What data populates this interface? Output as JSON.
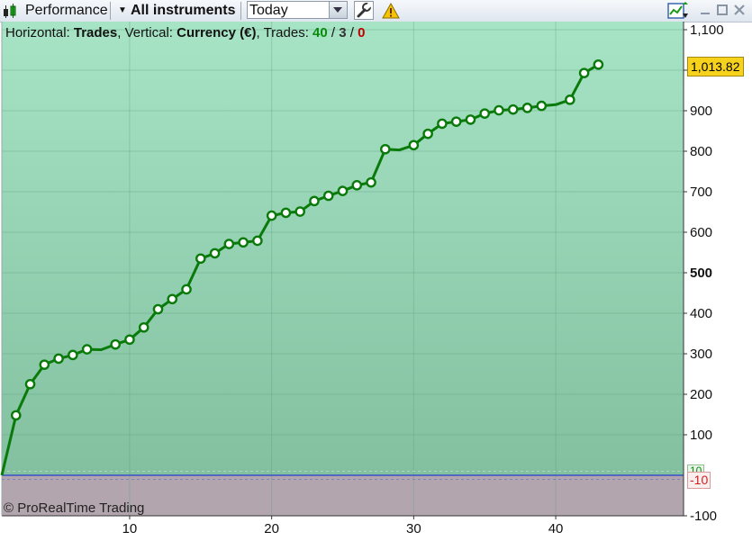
{
  "toolbar": {
    "module_label": "Performance",
    "instruments_label": "All instruments",
    "period_value": "Today",
    "icons": [
      "candlestick-icon",
      "dropdown-arrow-icon",
      "wrench-icon",
      "warning-icon",
      "chart-share-icon",
      "minimize-icon",
      "maximize-icon",
      "close-icon"
    ]
  },
  "info": {
    "horizontal_label": "Horizontal:",
    "horizontal_value": "Trades",
    "vertical_label": "Vertical:",
    "vertical_value": "Currency (€)",
    "trades_label": "Trades:",
    "trades_win": "40",
    "trades_even": "3",
    "trades_loss": "0",
    "separator": "/"
  },
  "copyright": "© ProRealTime Trading",
  "last_value_label": "1,013.82",
  "pos_tag": "10",
  "neg_tag": "-10",
  "colors": {
    "profit_bg_top": "#a7e4c6",
    "profit_bg_bottom": "#82c0a0",
    "loss_bg": "#b3a5ae",
    "line": "#0a7a0a",
    "baseline": "#3a50c8",
    "last_value_bg": "#f6d21d"
  },
  "chart_data": {
    "type": "line",
    "xlabel": "",
    "ylabel": "",
    "xlim": [
      1,
      49
    ],
    "ylim": [
      -100,
      1120
    ],
    "x_ticks": [
      10,
      20,
      30,
      40
    ],
    "y_ticks": [
      -100,
      100,
      200,
      300,
      400,
      500,
      600,
      700,
      800,
      900,
      1000,
      1100
    ],
    "y_tick_labels": [
      "-100",
      "100",
      "200",
      "300",
      "400",
      "500",
      "600",
      "700",
      "800",
      "900",
      "1,000",
      "1,100"
    ],
    "grid": true,
    "series": [
      {
        "x": [
          1,
          2,
          3,
          4,
          5,
          6,
          7,
          8,
          9,
          10,
          11,
          12,
          13,
          14,
          15,
          16,
          17,
          18,
          19,
          20,
          21,
          22,
          23,
          24,
          25,
          26,
          27,
          28,
          29,
          30,
          31,
          32,
          33,
          34,
          35,
          36,
          37,
          38,
          39,
          40,
          41,
          42,
          43
        ],
        "values": [
          0,
          148,
          225,
          273,
          288,
          297,
          311,
          310,
          323,
          335,
          365,
          410,
          435,
          459,
          535,
          548,
          571,
          575,
          579,
          641,
          648,
          651,
          677,
          690,
          702,
          716,
          723,
          805,
          803,
          815,
          843,
          868,
          873,
          878,
          893,
          901,
          903,
          907,
          912,
          915,
          927,
          993,
          1013.82
        ],
        "markers": [
          false,
          true,
          true,
          true,
          true,
          true,
          true,
          false,
          true,
          true,
          true,
          true,
          true,
          true,
          true,
          true,
          true,
          true,
          true,
          true,
          true,
          true,
          true,
          true,
          true,
          true,
          true,
          true,
          false,
          true,
          true,
          true,
          true,
          true,
          true,
          true,
          true,
          true,
          true,
          false,
          true,
          true,
          true
        ]
      }
    ]
  }
}
